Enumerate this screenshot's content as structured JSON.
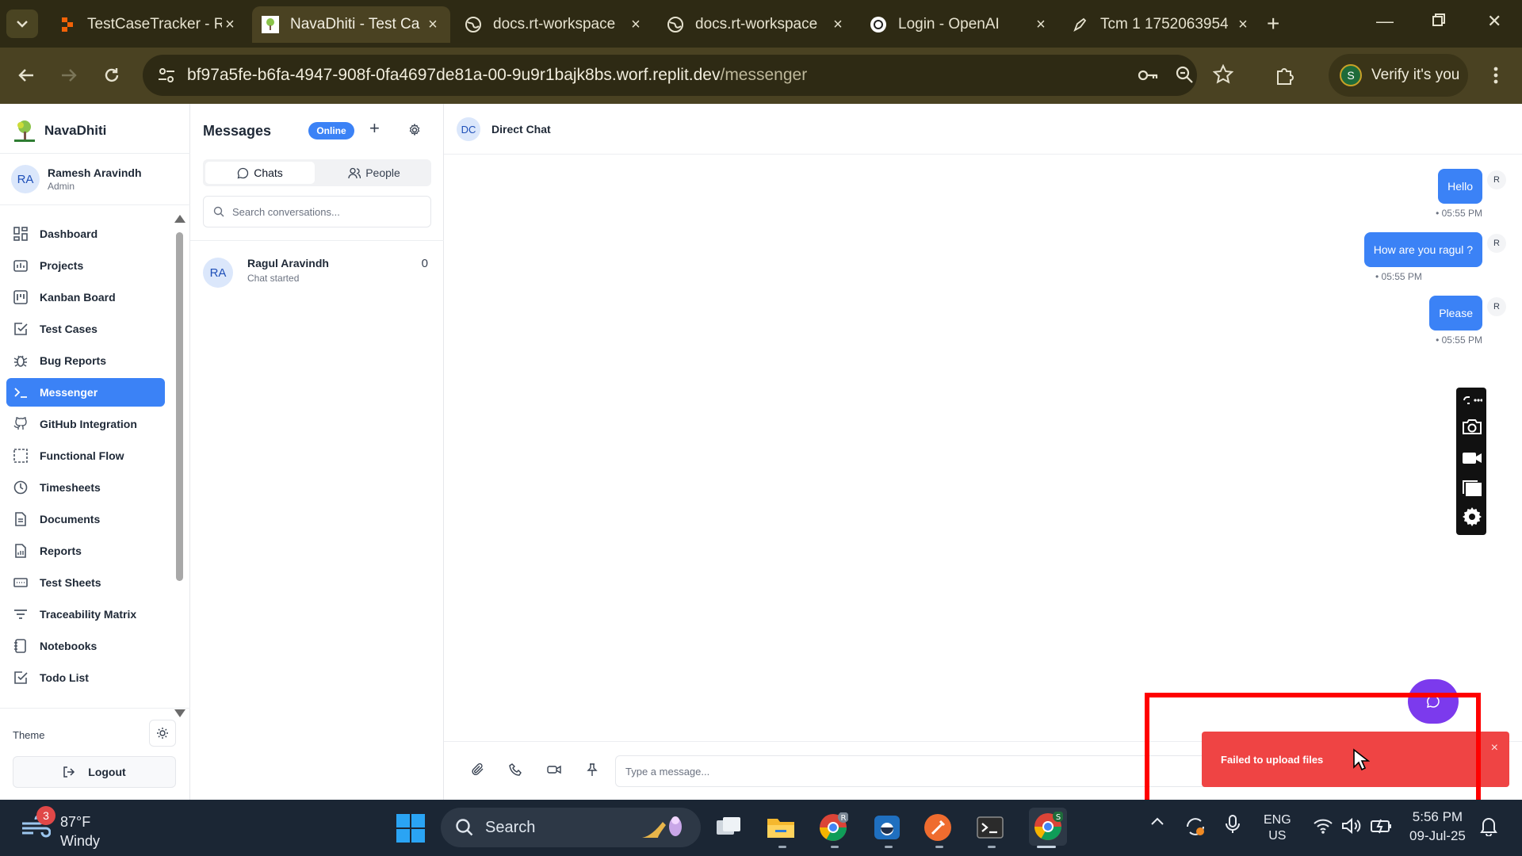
{
  "browser": {
    "tabs": [
      {
        "title": "TestCaseTracker - R",
        "active": false
      },
      {
        "title": "NavaDhiti - Test Ca",
        "active": true
      },
      {
        "title": "docs.rt-workspace",
        "active": false
      },
      {
        "title": "docs.rt-workspace",
        "active": false
      },
      {
        "title": "Login - OpenAI",
        "active": false
      },
      {
        "title": "Tcm 1 1752063954",
        "active": false
      }
    ],
    "url_host": "bf97a5fe-b6fa-4947-908f-0fa4697de81a-00-9u9r1bajk8bs.worf.replit.dev",
    "url_path": "/messenger",
    "profile_initial": "S",
    "profile_label": "Verify it's you"
  },
  "sidebar": {
    "brand": "NavaDhiti",
    "user_initials": "RA",
    "user_name": "Ramesh Aravindh",
    "user_role": "Admin",
    "items": [
      {
        "label": "Dashboard",
        "icon": "dashboard-icon",
        "active": false
      },
      {
        "label": "Projects",
        "icon": "projects-icon",
        "active": false
      },
      {
        "label": "Kanban Board",
        "icon": "kanban-icon",
        "active": false
      },
      {
        "label": "Test Cases",
        "icon": "checkbox-icon",
        "active": false
      },
      {
        "label": "Bug Reports",
        "icon": "bug-icon",
        "active": false
      },
      {
        "label": "Messenger",
        "icon": "terminal-icon",
        "active": true
      },
      {
        "label": "GitHub Integration",
        "icon": "github-icon",
        "active": false
      },
      {
        "label": "Functional Flow",
        "icon": "flow-icon",
        "active": false
      },
      {
        "label": "Timesheets",
        "icon": "clock-icon",
        "active": false
      },
      {
        "label": "Documents",
        "icon": "document-icon",
        "active": false
      },
      {
        "label": "Reports",
        "icon": "report-icon",
        "active": false
      },
      {
        "label": "Test Sheets",
        "icon": "sheet-icon",
        "active": false
      },
      {
        "label": "Traceability Matrix",
        "icon": "filter-icon",
        "active": false
      },
      {
        "label": "Notebooks",
        "icon": "notebook-icon",
        "active": false
      },
      {
        "label": "Todo List",
        "icon": "todo-icon",
        "active": false
      }
    ],
    "theme_label": "Theme",
    "logout_label": "Logout"
  },
  "messages_panel": {
    "title": "Messages",
    "status": "Online",
    "tab_chats": "Chats",
    "tab_people": "People",
    "search_placeholder": "Search conversations...",
    "conversations": [
      {
        "initials": "RA",
        "name": "Ragul Aravindh",
        "subtitle": "Chat started",
        "count": "0"
      }
    ]
  },
  "chat": {
    "header_initials": "DC",
    "header_title": "Direct Chat",
    "messages": [
      {
        "text": "Hello",
        "time": "• 05:55 PM",
        "sender": "R"
      },
      {
        "text": "How are you ragul ?",
        "time": "• 05:55 PM",
        "sender": "R"
      },
      {
        "text": "Please",
        "time": "• 05:55 PM",
        "sender": "R"
      }
    ],
    "input_placeholder": "Type a message..."
  },
  "toast": {
    "text": "Failed to upload files",
    "close": "×"
  },
  "taskbar": {
    "weather_badge": "3",
    "temperature": "87°F",
    "condition": "Windy",
    "search_label": "Search",
    "lang_top": "ENG",
    "lang_bottom": "US",
    "time": "5:56 PM",
    "date": "09-Jul-25"
  },
  "colors": {
    "accent": "#3b82f6",
    "toast": "#ef4444",
    "fab": "#7c3aed",
    "highlight_box": "#ff0000"
  }
}
